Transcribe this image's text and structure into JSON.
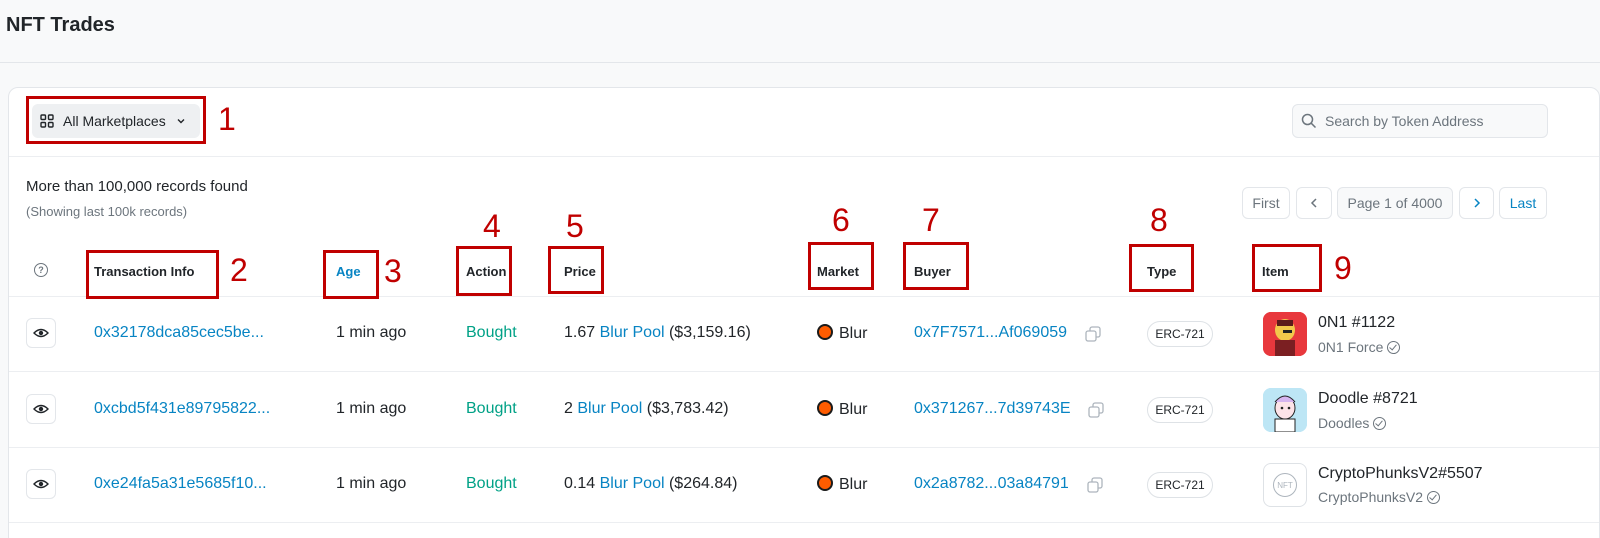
{
  "page": {
    "title": "NFT Trades"
  },
  "filters": {
    "marketplaces_label": "All Marketplaces",
    "search_placeholder": "Search by Token Address"
  },
  "summary": {
    "records": "More than 100,000 records found",
    "records_note": "(Showing last 100k records)"
  },
  "pagination": {
    "first": "First",
    "prev": "<",
    "page_info": "Page 1 of 4000",
    "next": ">",
    "last": "Last"
  },
  "table": {
    "headers": {
      "help": "?",
      "txn": "Transaction Info",
      "age": "Age",
      "action": "Action",
      "price": "Price",
      "market": "Market",
      "buyer": "Buyer",
      "type": "Type",
      "item": "Item"
    },
    "rows": [
      {
        "txn": "0x32178dca85cec5be...",
        "age": "1 min ago",
        "action": "Bought",
        "price_amount": "1.67",
        "price_token": "Blur Pool",
        "price_usd": "($3,159.16)",
        "market": "Blur",
        "buyer": "0x7F7571...Af069059",
        "type": "ERC-721",
        "item_name": "0N1 #1122",
        "item_collection": "0N1 Force"
      },
      {
        "txn": "0xcbd5f431e89795822...",
        "age": "1 min ago",
        "action": "Bought",
        "price_amount": "2",
        "price_token": "Blur Pool",
        "price_usd": "($3,783.42)",
        "market": "Blur",
        "buyer": "0x371267...7d39743E",
        "type": "ERC-721",
        "item_name": "Doodle #8721",
        "item_collection": "Doodles"
      },
      {
        "txn": "0xe24fa5a31e5685f10...",
        "age": "1 min ago",
        "action": "Bought",
        "price_amount": "0.14",
        "price_token": "Blur Pool",
        "price_usd": "($264.84)",
        "market": "Blur",
        "buyer": "0x2a8782...03a84791",
        "type": "ERC-721",
        "item_name": "CryptoPhunksV2#5507",
        "item_collection": "CryptoPhunksV2",
        "item_placeholder": "NFT"
      }
    ]
  },
  "annotations": [
    "1",
    "2",
    "3",
    "4",
    "5",
    "6",
    "7",
    "8",
    "9"
  ],
  "colors": {
    "link": "#0784c3",
    "action_green": "#00a186",
    "annotation_red": "#c00000",
    "blur_orange": "#ff5c00"
  },
  "icons": [
    "grid-icon",
    "chevron-down-icon",
    "search-icon",
    "help-circle-icon",
    "eye-icon",
    "blur-market-icon",
    "copy-icon",
    "verified-check-icon"
  ]
}
